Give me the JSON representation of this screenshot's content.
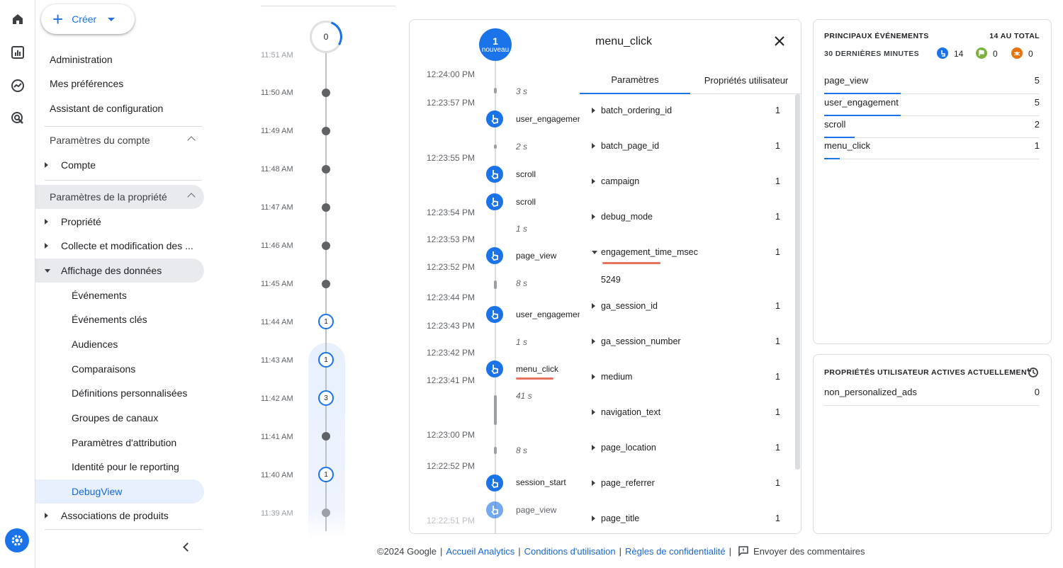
{
  "nav": {
    "create_label": "Créer",
    "items": [
      "Administration",
      "Mes préférences",
      "Assistant de configuration"
    ],
    "account_section": "Paramètres du compte",
    "account_child": "Compte",
    "property_section": "Paramètres de la propriété",
    "property_children": [
      "Propriété",
      "Collecte et modification des ...",
      "Affichage des données"
    ],
    "display_children": [
      "Événements",
      "Événements clés",
      "Audiences",
      "Comparaisons",
      "Définitions personnalisées",
      "Groupes de canaux",
      "Paramètres d'attribution",
      "Identité pour le reporting",
      "DebugView"
    ],
    "product_links": "Associations de produits"
  },
  "minutes": {
    "top_count": "0",
    "labels": [
      "11:51 AM",
      "11:50 AM",
      "11:49 AM",
      "11:48 AM",
      "11:47 AM",
      "11:46 AM",
      "11:45 AM",
      "11:44 AM",
      "11:43 AM",
      "11:42 AM",
      "11:41 AM",
      "11:40 AM",
      "11:39 AM"
    ],
    "counts": {
      "11:44 AM": "1",
      "11:43 AM": "1",
      "11:42 AM": "3",
      "11:40 AM": "1"
    }
  },
  "stream": {
    "badge_count": "1",
    "badge_label": "nouveau",
    "times": [
      "12:24:00 PM",
      "12:23:57 PM",
      "12:23:55 PM",
      "12:23:54 PM",
      "12:23:53 PM",
      "12:23:52 PM",
      "12:23:44 PM",
      "12:23:43 PM",
      "12:23:42 PM",
      "12:23:41 PM",
      "12:23:00 PM",
      "12:22:52 PM",
      "12:22:51 PM"
    ],
    "gaps": [
      "3 s",
      "2 s",
      "1 s",
      "8 s",
      "1 s",
      "41 s",
      "8 s"
    ],
    "events": [
      "user_engagement",
      "scroll",
      "scroll",
      "page_view",
      "user_engagement",
      "menu_click",
      "session_start",
      "page_view"
    ]
  },
  "details": {
    "title": "menu_click",
    "tabs": [
      "Paramètres",
      "Propriétés utilisateur"
    ],
    "params": [
      {
        "name": "batch_ordering_id",
        "count": "1"
      },
      {
        "name": "batch_page_id",
        "count": "1"
      },
      {
        "name": "campaign",
        "count": "1"
      },
      {
        "name": "debug_mode",
        "count": "1"
      },
      {
        "name": "engagement_time_msec",
        "count": "1"
      },
      {
        "name": "ga_session_id",
        "count": "1"
      },
      {
        "name": "ga_session_number",
        "count": "1"
      },
      {
        "name": "medium",
        "count": "1"
      },
      {
        "name": "navigation_text",
        "count": "1"
      },
      {
        "name": "page_location",
        "count": "1"
      },
      {
        "name": "page_referrer",
        "count": "1"
      },
      {
        "name": "page_title",
        "count": "1"
      }
    ],
    "expanded_value": "5249"
  },
  "top_events": {
    "heading": "PRINCIPAUX ÉVÉNEMENTS",
    "total": "14 AU TOTAL",
    "subheading": "30 DERNIÈRES MINUTES",
    "stats": {
      "events": "14",
      "key_events": "0",
      "errors": "0"
    },
    "rows": [
      {
        "name": "page_view",
        "value": "5"
      },
      {
        "name": "user_engagement",
        "value": "5"
      },
      {
        "name": "scroll",
        "value": "2"
      },
      {
        "name": "menu_click",
        "value": "1"
      }
    ]
  },
  "user_props": {
    "heading": "PROPRIÉTÉS UTILISATEUR ACTIVES ACTUELLEMENT",
    "rows": [
      {
        "name": "non_personalized_ads",
        "value": "0"
      }
    ]
  },
  "footer": {
    "copyright": "©2024 Google",
    "links": [
      "Accueil Analytics",
      "Conditions d'utilisation",
      "Règles de confidentialité"
    ],
    "feedback": "Envoyer des commentaires"
  },
  "colors": {
    "accent": "#1a73e8",
    "active_bg": "#e8f0fe",
    "highlight_underline": "#e8715d"
  }
}
